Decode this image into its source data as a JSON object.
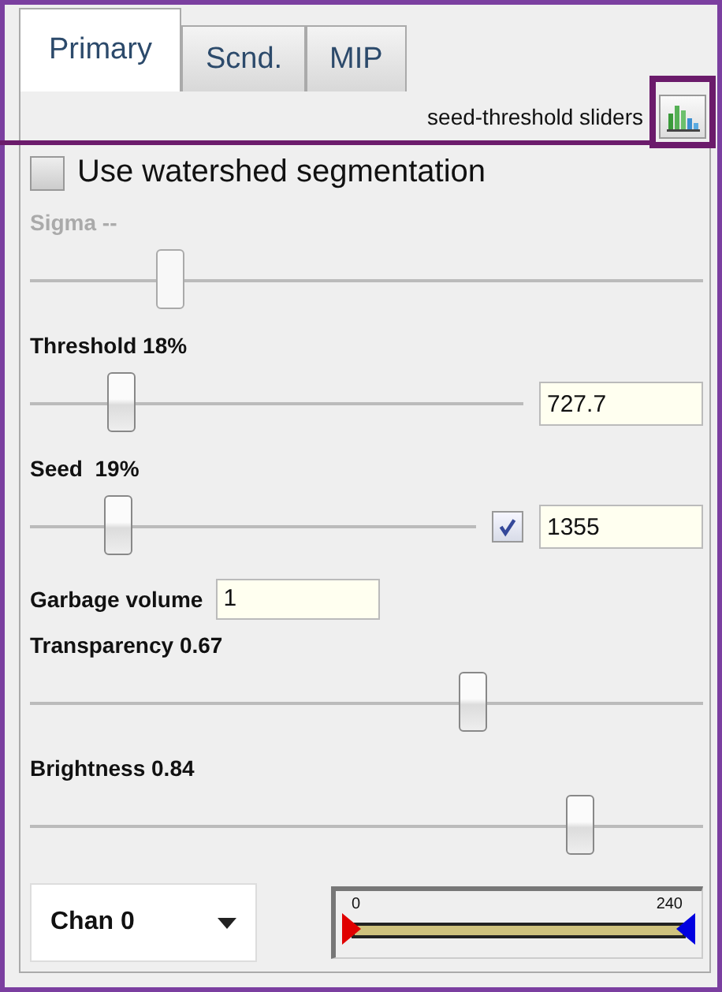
{
  "tabs": [
    {
      "label": "Primary",
      "selected": true
    },
    {
      "label": "Scnd.",
      "selected": false
    },
    {
      "label": "MIP",
      "selected": false
    }
  ],
  "header": {
    "label": "seed-threshold sliders"
  },
  "watershed": {
    "label": "Use watershed segmentation",
    "checked": false
  },
  "sliders": [
    {
      "label": "Sigma --",
      "disabled": true,
      "level": 0.21
    },
    {
      "label": "Threshold 18%",
      "disabled": false,
      "level": 0.19,
      "value": "727.7"
    },
    {
      "label": "Seed  19%",
      "disabled": false,
      "level": 0.2,
      "value": "1355",
      "checked": true
    },
    {
      "kind": "field",
      "label": "Garbage volume",
      "value": "1"
    },
    {
      "label": "Transparency 0.67",
      "disabled": false,
      "level": 0.66
    },
    {
      "label": "Brightness 0.84",
      "disabled": false,
      "level": 0.82
    }
  ],
  "channel": {
    "value": "Chan 0"
  },
  "range": {
    "min": "0",
    "max": "240"
  }
}
